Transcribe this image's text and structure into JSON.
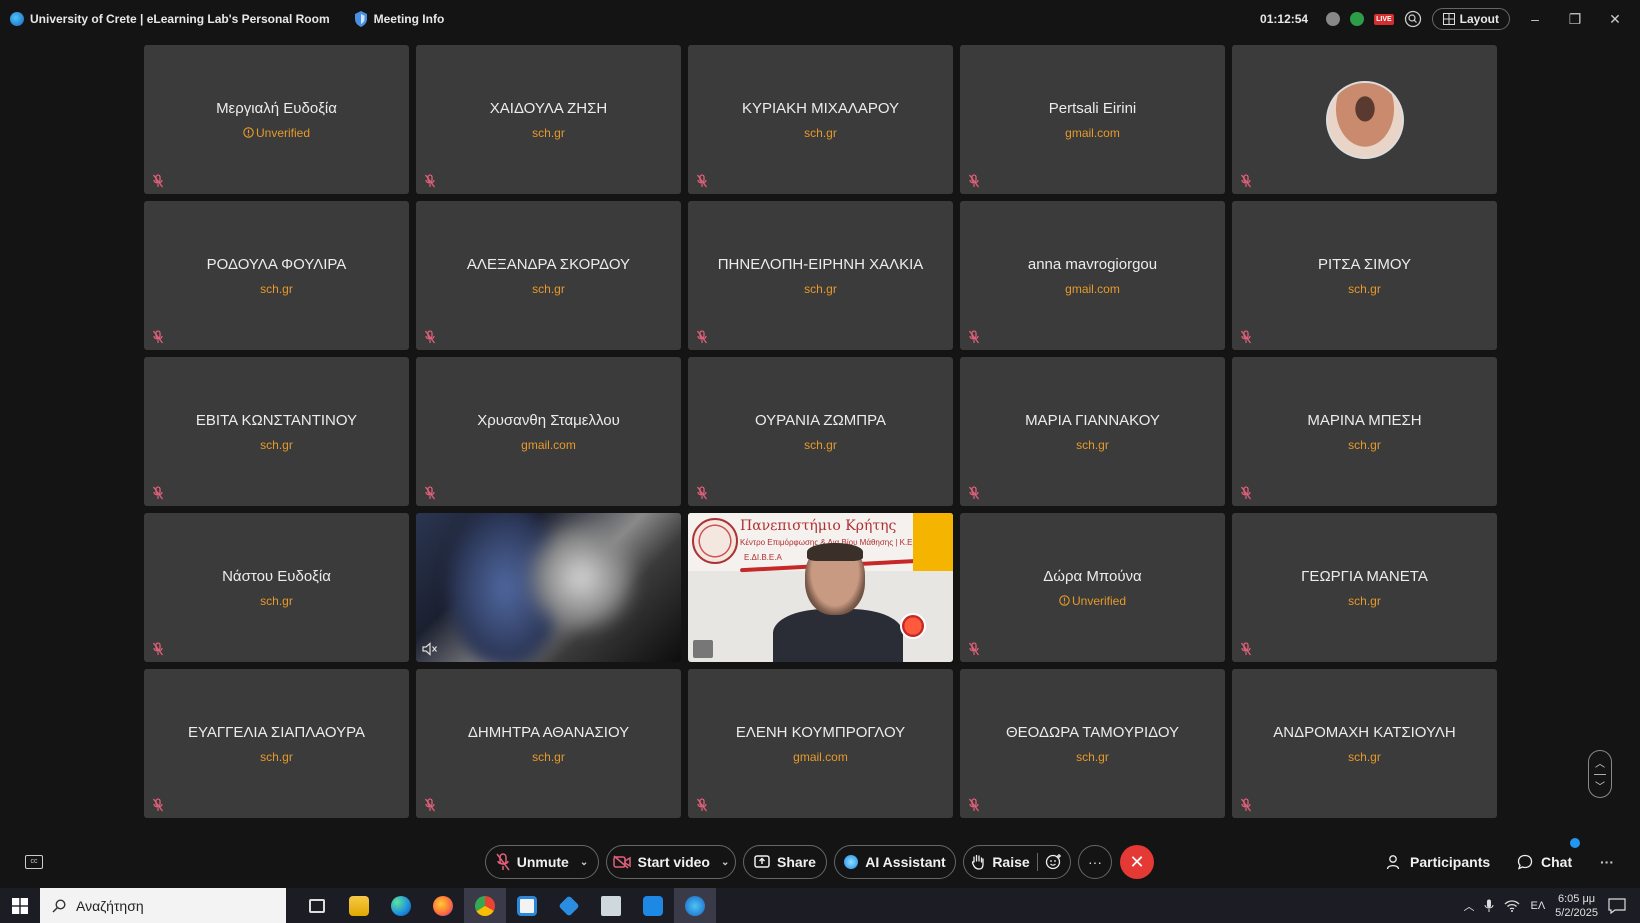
{
  "window": {
    "title": "University of Crete | eLearning Lab's Personal Room",
    "meeting_info": "Meeting Info",
    "timer": "01:12:54",
    "layout_label": "Layout",
    "live_badge": "LIVE"
  },
  "participants": [
    {
      "name": "Μεργιαλή Ευδοξία",
      "sub": "Unverified",
      "unverified": true
    },
    {
      "name": "ΧΑΙΔΟΥΛΑ ΖΗΣΗ",
      "sub": "sch.gr"
    },
    {
      "name": "ΚΥΡΙΑΚΗ ΜΙΧΑΛΑΡΟΥ",
      "sub": "sch.gr"
    },
    {
      "name": "Pertsali Eirini",
      "sub": "gmail.com"
    },
    {
      "name": "",
      "sub": "",
      "avatar": true
    },
    {
      "name": "ΡΟΔΟΥΛΑ ΦΟΥΛΙΡΑ",
      "sub": "sch.gr"
    },
    {
      "name": "ΑΛΕΞΑΝΔΡΑ ΣΚΟΡΔΟΥ",
      "sub": "sch.gr"
    },
    {
      "name": "ΠΗΝΕΛΟΠΗ-ΕΙΡΗΝΗ ΧΑΛΚΙΑ",
      "sub": "sch.gr"
    },
    {
      "name": "anna mavrogiorgou",
      "sub": "gmail.com"
    },
    {
      "name": "ΡΙΤΣΑ ΣΙΜΟΥ",
      "sub": "sch.gr"
    },
    {
      "name": "ΕΒΙΤΑ ΚΩΝΣΤΑΝΤΙΝΟΥ",
      "sub": "sch.gr"
    },
    {
      "name": "Χρυσανθη Σταμελλου",
      "sub": "gmail.com"
    },
    {
      "name": "ΟΥΡΑΝΙΑ ΖΩΜΠΡΑ",
      "sub": "sch.gr"
    },
    {
      "name": "ΜΑΡΙΑ ΓΙΑΝΝΑΚΟΥ",
      "sub": "sch.gr"
    },
    {
      "name": "ΜΑΡΙΝΑ ΜΠΕΣΗ",
      "sub": "sch.gr"
    },
    {
      "name": "Νάστου Ευδοξία",
      "sub": "sch.gr"
    },
    {
      "name": "",
      "sub": "",
      "video": "blur"
    },
    {
      "name": "",
      "sub": "",
      "video": "speaker"
    },
    {
      "name": "Δώρα Μπούνα",
      "sub": "Unverified",
      "unverified": true
    },
    {
      "name": "ΓΕΩΡΓΙΑ ΜΑΝΕΤΑ",
      "sub": "sch.gr"
    },
    {
      "name": "ΕΥΑΓΓΕΛΙΑ ΣΙΑΠΛΑΟΥΡΑ",
      "sub": "sch.gr"
    },
    {
      "name": "ΔΗΜΗΤΡΑ ΑΘΑΝΑΣΙΟΥ",
      "sub": "sch.gr"
    },
    {
      "name": "ΕΛΕΝΗ ΚΟΥΜΠΡΟΓΛΟΥ",
      "sub": "gmail.com"
    },
    {
      "name": "ΘΕΟΔΩΡΑ ΤΑΜΟΥΡΙΔΟΥ",
      "sub": "sch.gr"
    },
    {
      "name": "ΑΝΔΡΟΜΑΧΗ ΚΑΤΣΙΟΥΛΗ",
      "sub": "sch.gr"
    }
  ],
  "speaker_banner": {
    "university": "Πανεπιστήμιο Κρήτης",
    "center": "Κέντρο Επιμόρφωσης & Δια Βίου Μάθησης | Κ.Ε.ΔΙ.ΒΙ.Μ",
    "unit": "Ε.ΔΙ.Β.Ε.Α"
  },
  "controls": {
    "unmute": "Unmute",
    "start_video": "Start video",
    "share": "Share",
    "ai_assistant": "AI Assistant",
    "raise": "Raise",
    "participants": "Participants",
    "chat": "Chat",
    "more": "···"
  },
  "taskbar": {
    "search_placeholder": "Αναζήτηση",
    "language": "ΕΛ",
    "time": "6:05 μμ",
    "date": "5/2/2025"
  },
  "colors": {
    "tile_bg": "#3b3b3b",
    "domain_text": "#e59a2b",
    "end_call": "#e53935",
    "mic_muted": "#e0607a"
  }
}
